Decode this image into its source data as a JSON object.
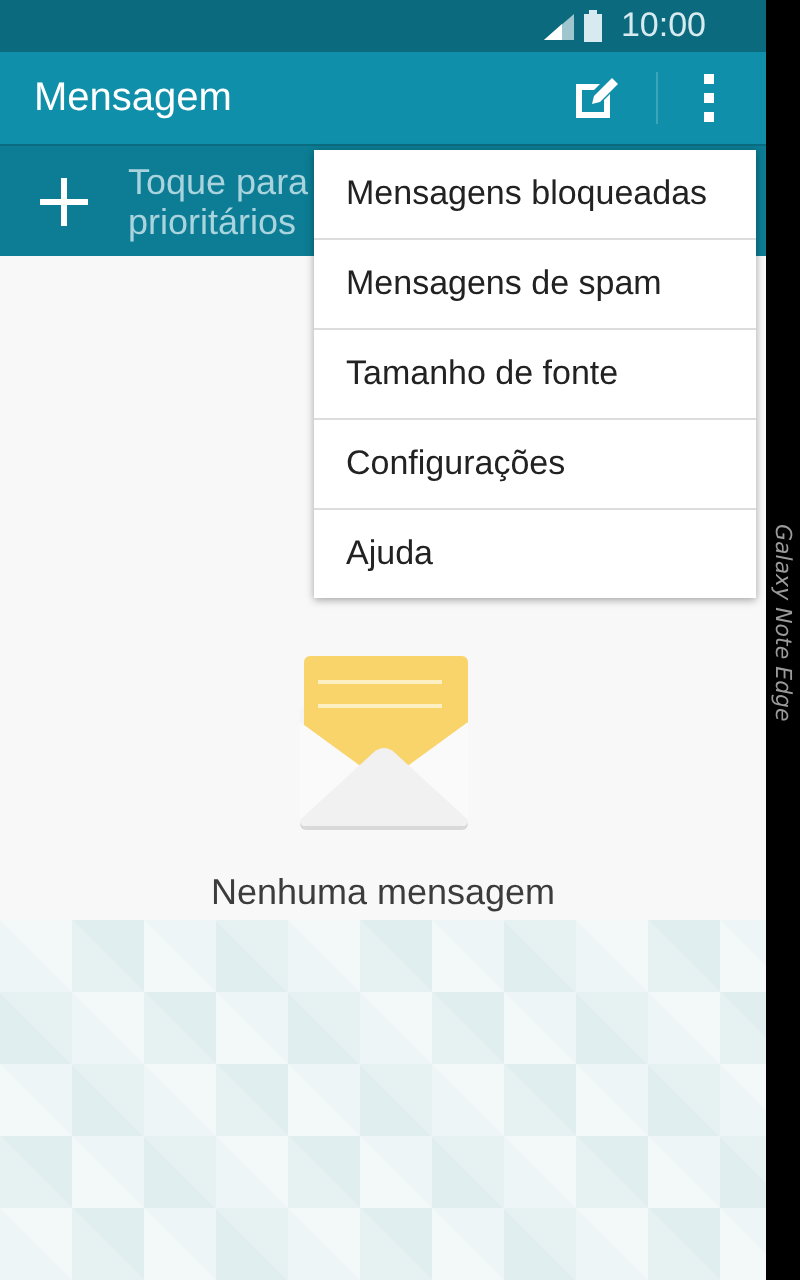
{
  "status_bar": {
    "time": "10:00"
  },
  "app_bar": {
    "title": "Mensagem"
  },
  "priority_bar": {
    "lines": [
      "Toque para",
      "prioritários"
    ]
  },
  "menu": {
    "items": [
      {
        "label": "Mensagens bloqueadas"
      },
      {
        "label": "Mensagens de spam"
      },
      {
        "label": "Tamanho de fonte"
      },
      {
        "label": "Configurações"
      },
      {
        "label": "Ajuda"
      }
    ]
  },
  "empty_state": {
    "text": "Nenhuma mensagem"
  },
  "edge_panel": {
    "text": "Galaxy Note Edge"
  }
}
